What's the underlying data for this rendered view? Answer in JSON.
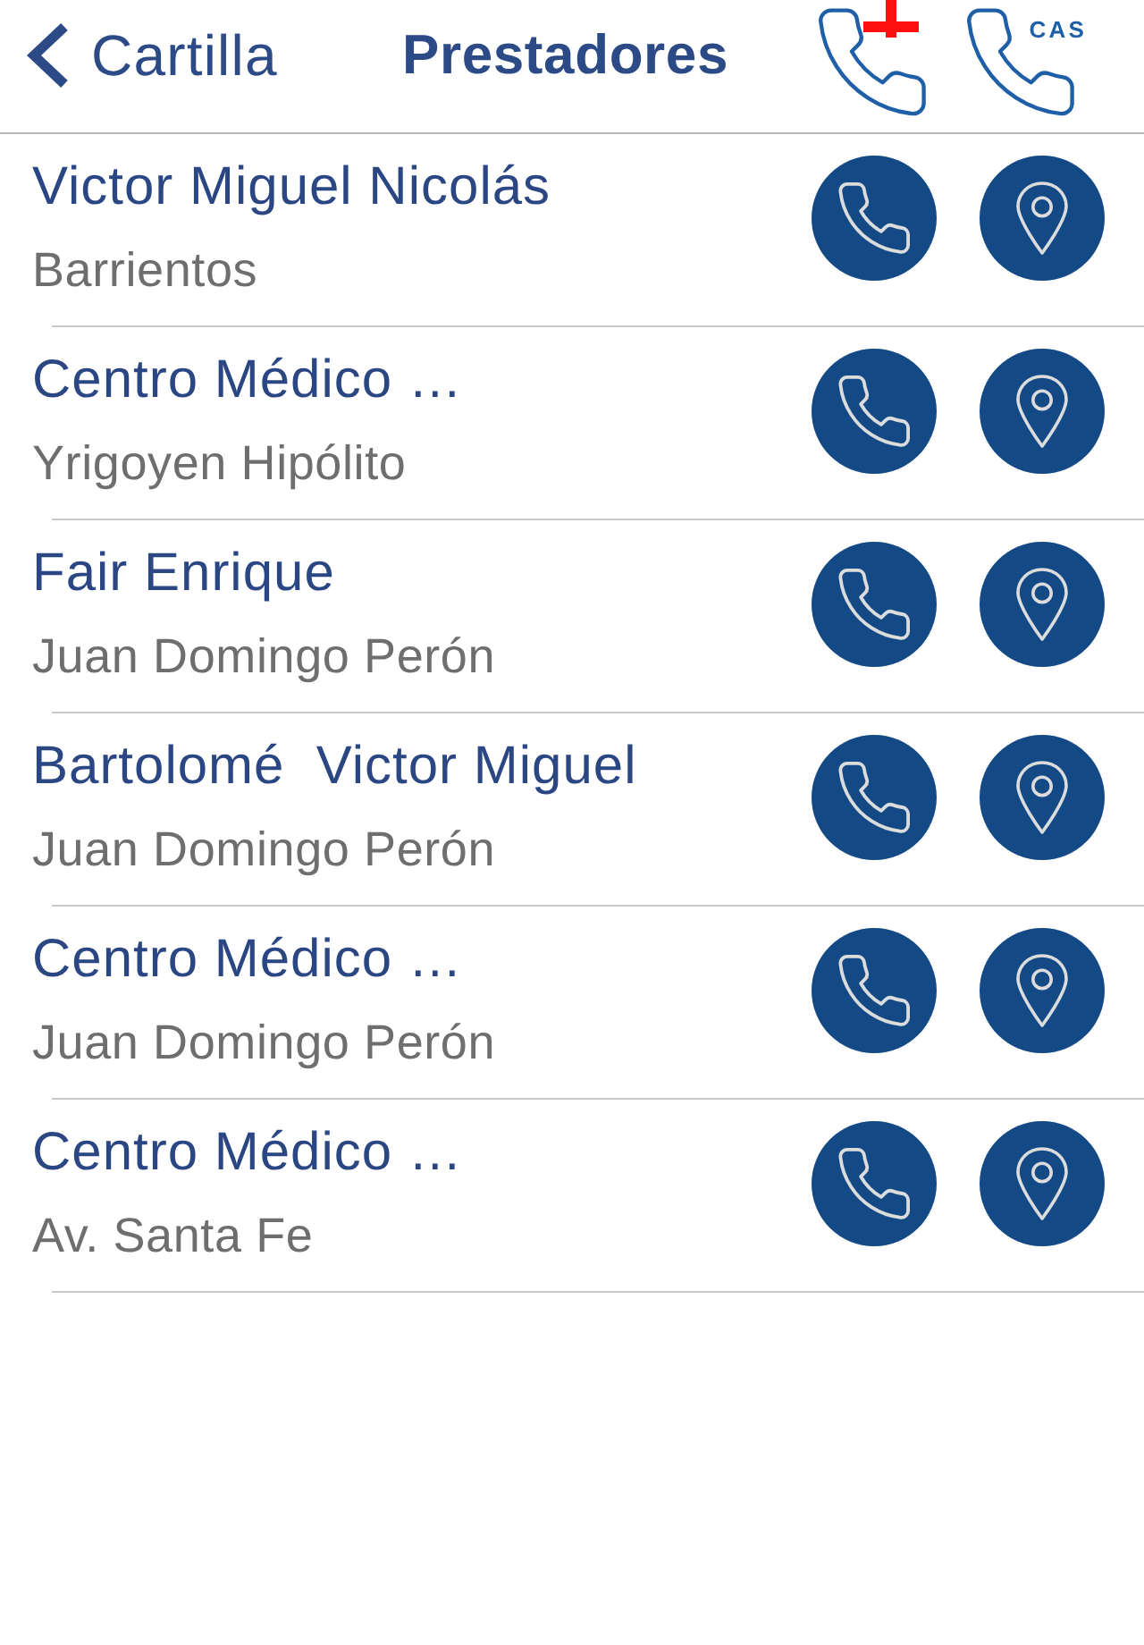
{
  "nav_bar": {
    "back_label": "Cartilla",
    "title": "Prestadores",
    "call_buttons": [
      {
        "kind": "emergency"
      },
      {
        "kind": "labeled",
        "label": "CAS"
      }
    ]
  },
  "providers": [
    {
      "name": "Victor Miguel Nicolás",
      "subtitle": "Barrientos"
    },
    {
      "name": "Centro Médico …",
      "subtitle": "Yrigoyen Hipólito"
    },
    {
      "name": "Fair Enrique",
      "subtitle": "Juan Domingo Perón"
    },
    {
      "name": "Bartolomé  Victor Miguel",
      "subtitle": "Juan Domingo Perón"
    },
    {
      "name": "Centro Médico …",
      "subtitle": "Juan Domingo Perón"
    },
    {
      "name": "Centro Médico …",
      "subtitle": "Av. Santa Fe"
    }
  ]
}
